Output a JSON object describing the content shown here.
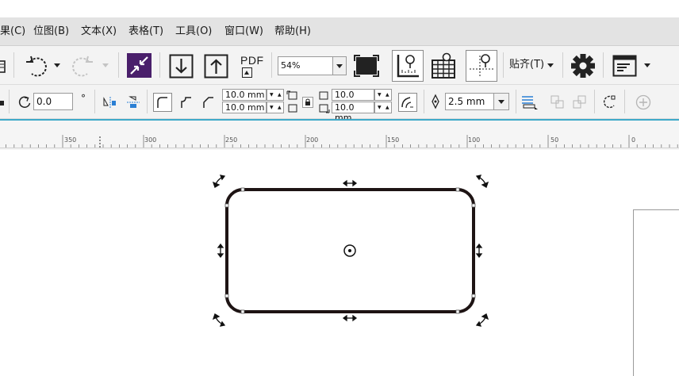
{
  "menubar": {
    "items": [
      {
        "label": "果(C)"
      },
      {
        "label": "位图(B)"
      },
      {
        "label": "文本(X)"
      },
      {
        "label": "表格(T)"
      },
      {
        "label": "工具(O)"
      },
      {
        "label": "窗口(W)"
      },
      {
        "label": "帮助(H)"
      }
    ]
  },
  "toolbar": {
    "pdf_label": "PDF",
    "zoom_value": "54%",
    "snap_label": "贴齐(T)"
  },
  "property_bar": {
    "rotation_value": "0.0",
    "degree_symbol": "°",
    "corner_width_top": "10.0 mm",
    "corner_width_bottom": "10.0 mm",
    "corner_right_top": "10.0 mm",
    "corner_right_bottom": "10.0 mm",
    "outline_width": "2.5 mm"
  },
  "ruler": {
    "labels": [
      "350",
      "300",
      "250",
      "200",
      "150",
      "100",
      "50",
      "0"
    ]
  },
  "colors": {
    "menubar_bg": "#e3e3e3",
    "toolbar_bg": "#f3f3f3",
    "ruler_accent": "#3ea9c9",
    "shape_stroke": "#1e1414",
    "fit_icon_purple": "#4a1f6b"
  }
}
